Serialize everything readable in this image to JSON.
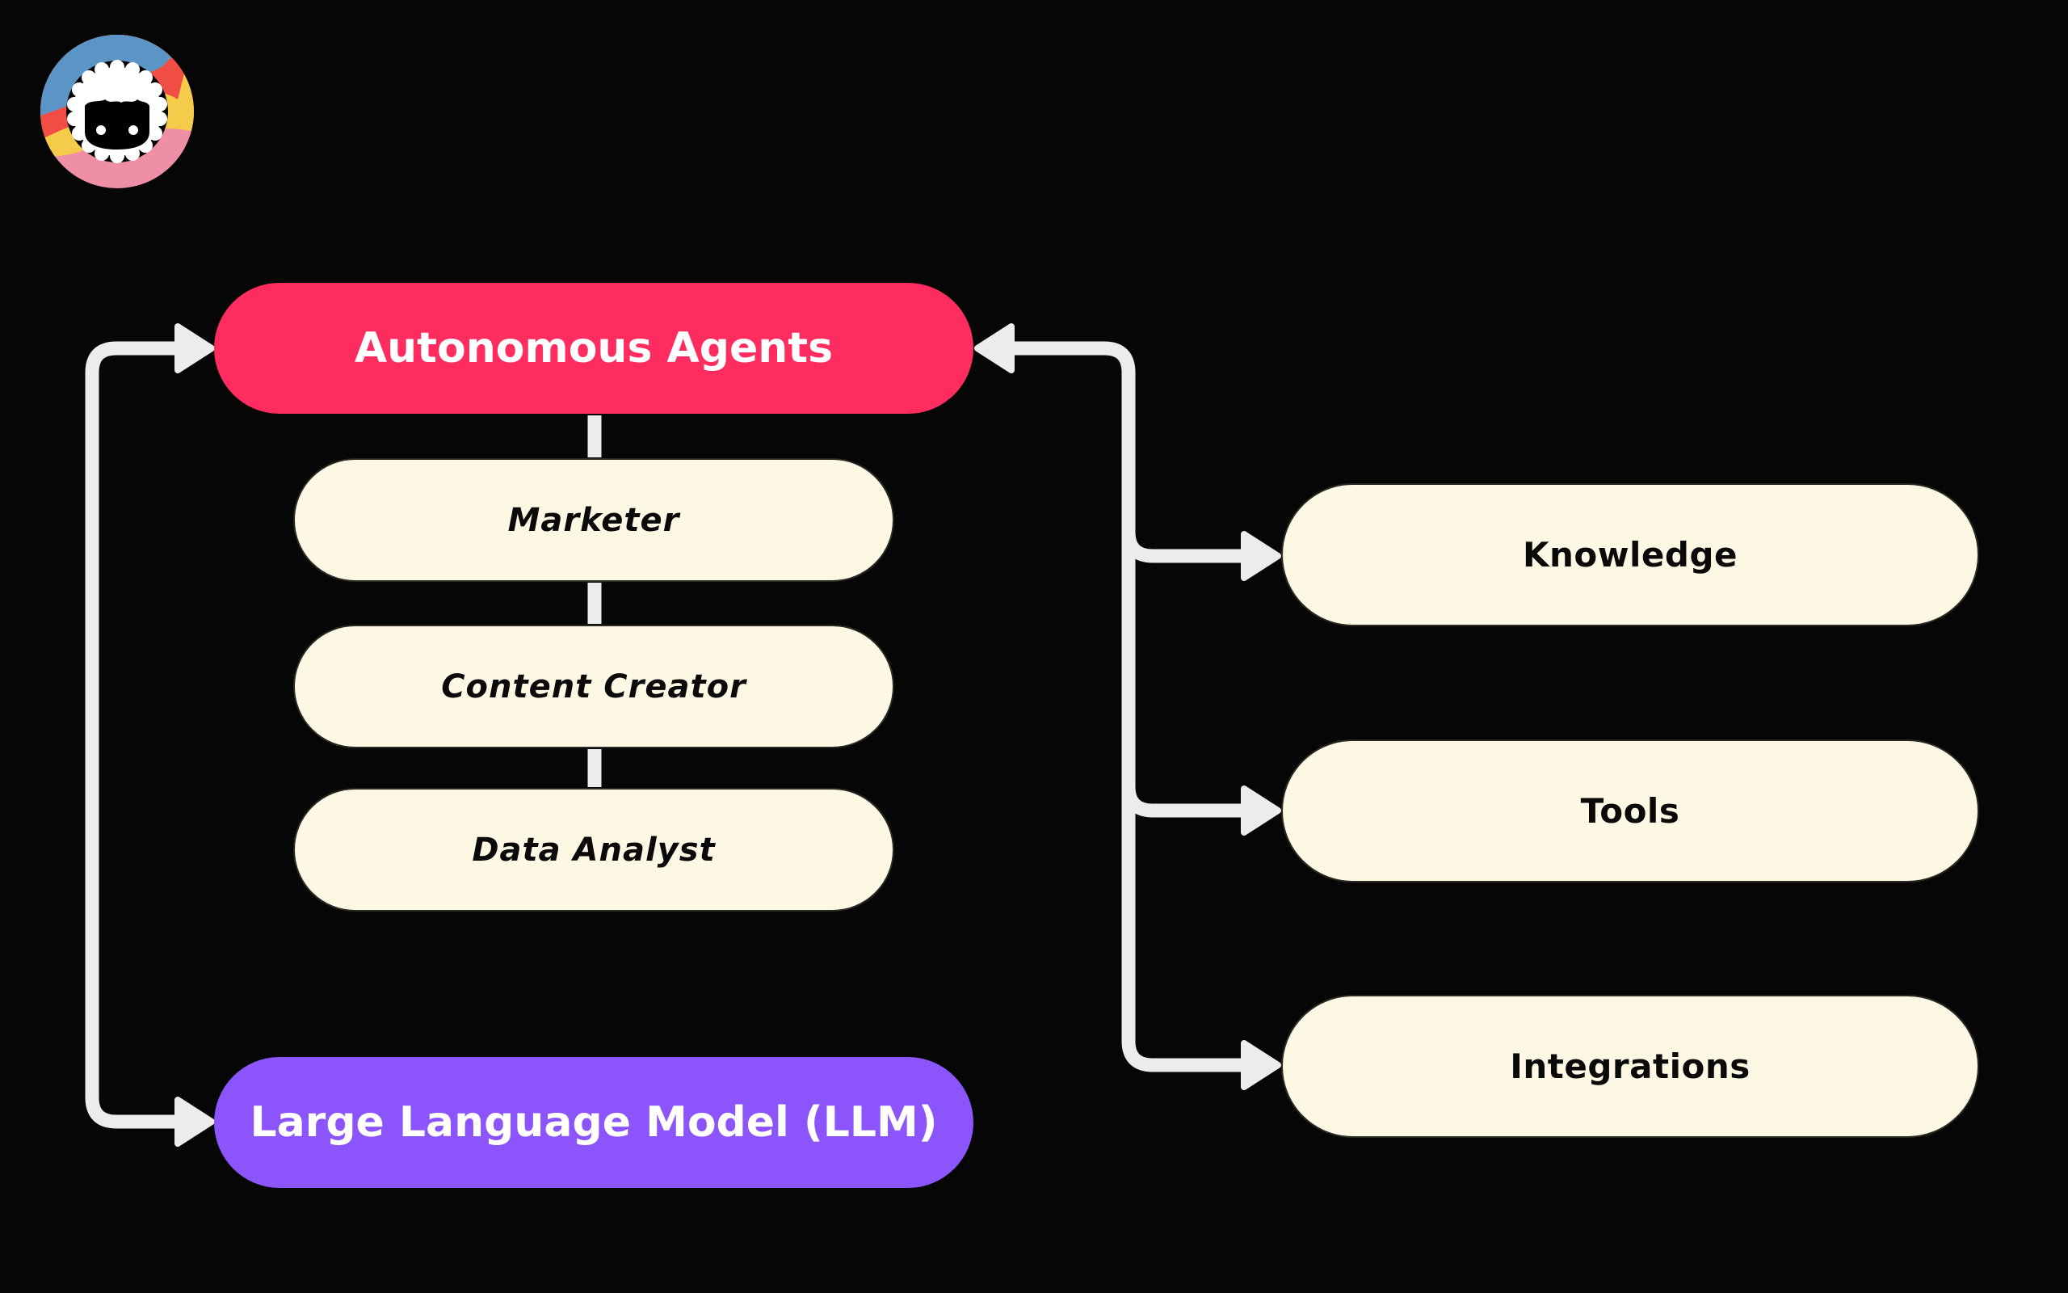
{
  "logo": {
    "icon": "sheep-logo-icon",
    "ring_colors": [
      "#5b95c6",
      "#f04e45",
      "#f5cc4a",
      "#ef8fa6"
    ]
  },
  "colors": {
    "background": "#060606",
    "agents_node": "#ff2d5f",
    "llm_node": "#8b55fb",
    "cream_node": "#fdf8e3",
    "connector": "#ececec"
  },
  "diagram": {
    "autonomous_agents": "Autonomous Agents",
    "llm": "Large Language Model (LLM)",
    "agent_roles": [
      {
        "label": "Marketer"
      },
      {
        "label": "Content Creator"
      },
      {
        "label": "Data Analyst"
      }
    ],
    "resources": [
      {
        "label": "Knowledge"
      },
      {
        "label": "Tools"
      },
      {
        "label": "Integrations"
      }
    ],
    "edges": [
      {
        "from": "Large Language Model (LLM)",
        "to": "Autonomous Agents",
        "type": "bidirectional"
      },
      {
        "from": "Autonomous Agents",
        "to": "Marketer",
        "type": "line"
      },
      {
        "from": "Marketer",
        "to": "Content Creator",
        "type": "line"
      },
      {
        "from": "Content Creator",
        "to": "Data Analyst",
        "type": "line"
      },
      {
        "from": "Knowledge",
        "to": "Autonomous Agents",
        "type": "arrow"
      },
      {
        "from": "Autonomous Agents",
        "to": "Knowledge",
        "type": "arrow"
      },
      {
        "from": "Autonomous Agents",
        "to": "Tools",
        "type": "arrow"
      },
      {
        "from": "Autonomous Agents",
        "to": "Integrations",
        "type": "arrow"
      }
    ]
  }
}
